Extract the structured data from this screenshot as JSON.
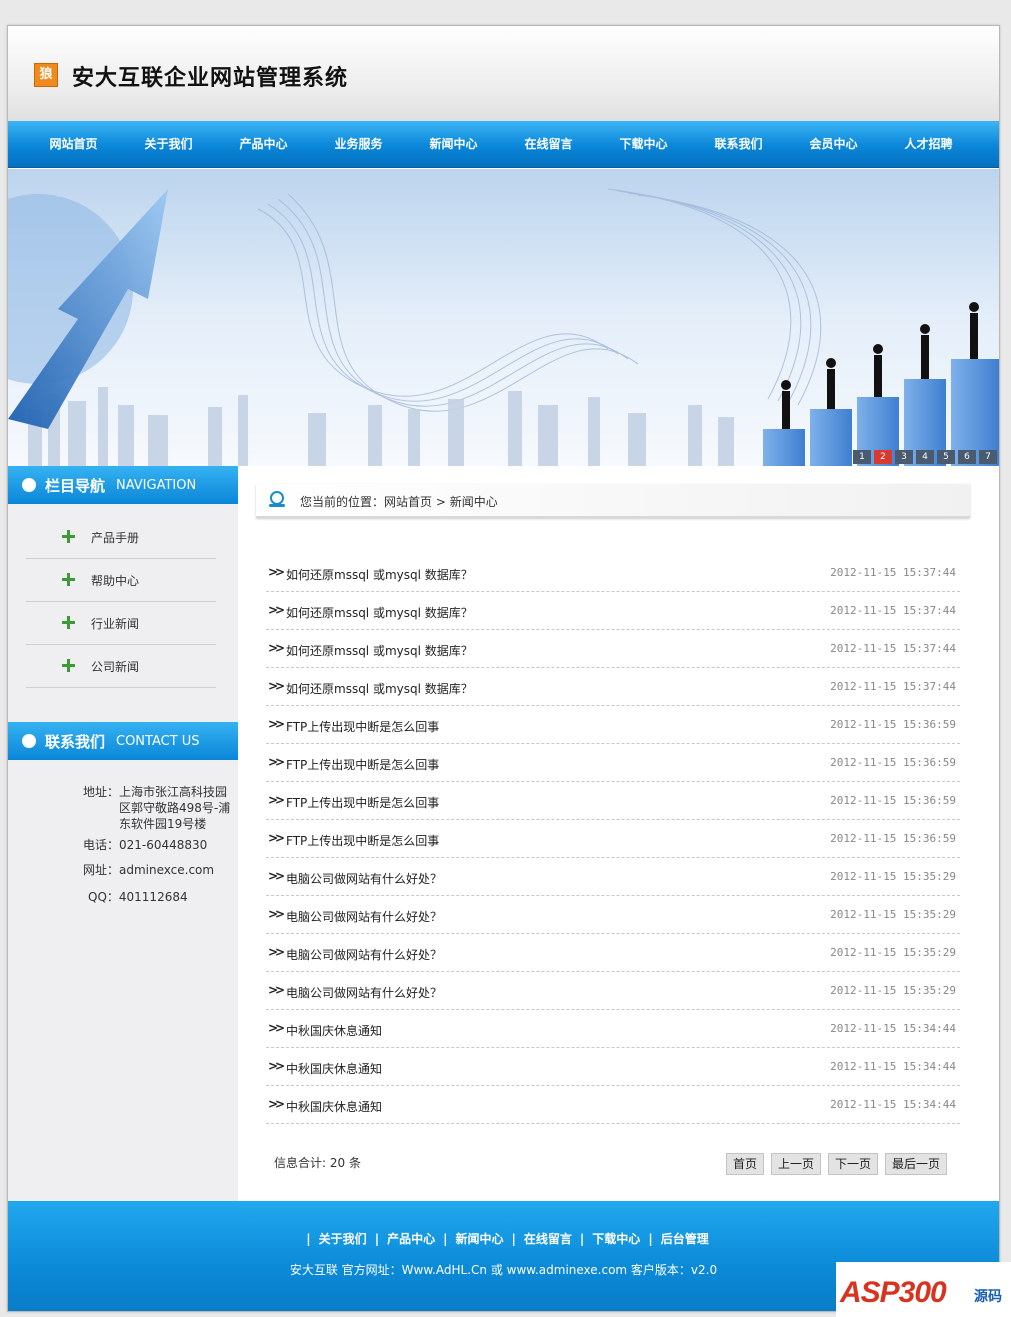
{
  "header": {
    "logo_char": "狼",
    "title": "安大互联企业网站管理系统"
  },
  "nav": [
    "网站首页",
    "关于我们",
    "产品中心",
    "业务服务",
    "新闻中心",
    "在线留言",
    "下载中心",
    "联系我们",
    "会员中心",
    "人才招聘"
  ],
  "banner": {
    "slides": [
      "1",
      "2",
      "3",
      "4",
      "5",
      "6",
      "7"
    ],
    "active": 2
  },
  "sidebar": {
    "nav_title_cn": "栏目导航",
    "nav_title_en": "NAVIGATION",
    "items": [
      "产品手册",
      "帮助中心",
      "行业新闻",
      "公司新闻"
    ],
    "contact_title_cn": "联系我们",
    "contact_title_en": "CONTACT US",
    "contact": {
      "address_label": "地址：",
      "address_lines": [
        "上海市张江高科技园",
        "区郭守敬路498号-浦",
        "东软件园19号楼"
      ],
      "phone": "电话：021-60448830",
      "web": "网址：adminexce.com",
      "qq": "QQ：401112684"
    }
  },
  "breadcrumb": {
    "prefix": "您当前的位置：",
    "home": "网站首页",
    "sep": " > ",
    "current": "新闻中心"
  },
  "news": [
    {
      "title": "如何还原mssql 或mysql 数据库？",
      "date": "2012-11-15 15:37:44"
    },
    {
      "title": "如何还原mssql 或mysql 数据库？",
      "date": "2012-11-15 15:37:44"
    },
    {
      "title": "如何还原mssql 或mysql 数据库？",
      "date": "2012-11-15 15:37:44"
    },
    {
      "title": "如何还原mssql 或mysql 数据库？",
      "date": "2012-11-15 15:37:44"
    },
    {
      "title": "FTP上传出现中断是怎么回事",
      "date": "2012-11-15 15:36:59"
    },
    {
      "title": "FTP上传出现中断是怎么回事",
      "date": "2012-11-15 15:36:59"
    },
    {
      "title": "FTP上传出现中断是怎么回事",
      "date": "2012-11-15 15:36:59"
    },
    {
      "title": "FTP上传出现中断是怎么回事",
      "date": "2012-11-15 15:36:59"
    },
    {
      "title": "电脑公司做网站有什么好处？",
      "date": "2012-11-15 15:35:29"
    },
    {
      "title": "电脑公司做网站有什么好处？",
      "date": "2012-11-15 15:35:29"
    },
    {
      "title": "电脑公司做网站有什么好处？",
      "date": "2012-11-15 15:35:29"
    },
    {
      "title": "电脑公司做网站有什么好处？",
      "date": "2012-11-15 15:35:29"
    },
    {
      "title": "中秋国庆休息通知",
      "date": "2012-11-15 15:34:44"
    },
    {
      "title": "中秋国庆休息通知",
      "date": "2012-11-15 15:34:44"
    },
    {
      "title": "中秋国庆休息通知",
      "date": "2012-11-15 15:34:44"
    }
  ],
  "total": "信息合计: 20 条",
  "pager": [
    "首页",
    "上一页",
    "下一页",
    "最后一页"
  ],
  "footer": {
    "links": [
      "关于我们",
      "产品中心",
      "新闻中心",
      "在线留言",
      "下载中心",
      "后台管理"
    ],
    "copyright": "安大互联 官方网址：Www.AdHL.Cn 或 www.adminexe.com 客户版本：v2.0"
  },
  "watermark": {
    "main": "ASP300",
    "sub": "源码"
  }
}
